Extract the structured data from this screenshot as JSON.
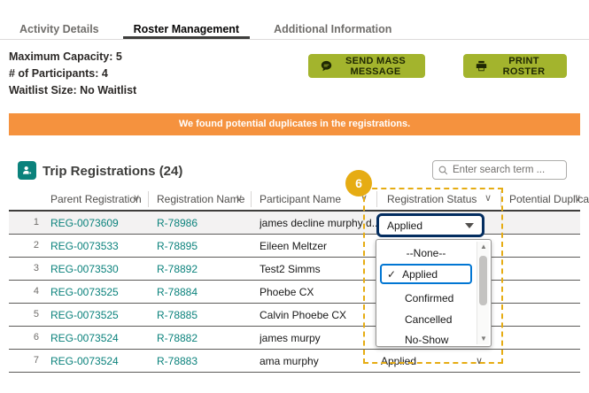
{
  "tabs": [
    {
      "label": "Activity Details",
      "active": false
    },
    {
      "label": "Roster Management",
      "active": true
    },
    {
      "label": "Additional Information",
      "active": false
    }
  ],
  "summary": {
    "max_capacity": "Maximum Capacity: 5",
    "participants": "# of Participants: 4",
    "waitlist": "Waitlist Size: No Waitlist"
  },
  "actions": {
    "send_mass_message": "SEND MASS MESSAGE",
    "print_roster": "PRINT ROSTER",
    "button_color": "#a3b42d"
  },
  "banner": {
    "text": "We found potential duplicates in the registrations.",
    "color": "#f5923e"
  },
  "section": {
    "title": "Trip Registrations (24)",
    "icon": "people-icon",
    "icon_color": "#0b827c"
  },
  "search": {
    "placeholder": "Enter search term ..."
  },
  "table": {
    "columns": [
      {
        "label": "Parent Registration"
      },
      {
        "label": "Registration Name"
      },
      {
        "label": "Participant Name"
      },
      {
        "label": "Registration Status"
      },
      {
        "label": "Potential Duplicate"
      }
    ],
    "link_color": "#0b827c",
    "rows": [
      {
        "num": "1",
        "parent": "REG-0073609",
        "reg_name": "R-78986",
        "participant": "james decline murphy d...",
        "status": "Applied",
        "duplicate": ""
      },
      {
        "num": "2",
        "parent": "REG-0073533",
        "reg_name": "R-78895",
        "participant": "Eileen Meltzer",
        "status": "",
        "duplicate": ""
      },
      {
        "num": "3",
        "parent": "REG-0073530",
        "reg_name": "R-78892",
        "participant": "Test2 Simms",
        "status": "",
        "duplicate": ""
      },
      {
        "num": "4",
        "parent": "REG-0073525",
        "reg_name": "R-78884",
        "participant": "Phoebe CX",
        "status": "",
        "duplicate": ""
      },
      {
        "num": "5",
        "parent": "REG-0073525",
        "reg_name": "R-78885",
        "participant": "Calvin Phoebe CX",
        "status": "",
        "duplicate": ""
      },
      {
        "num": "6",
        "parent": "REG-0073524",
        "reg_name": "R-78882",
        "participant": "james murpy",
        "status": "",
        "duplicate": ""
      },
      {
        "num": "7",
        "parent": "REG-0073524",
        "reg_name": "R-78883",
        "participant": "ama murphy",
        "status": "Applied",
        "duplicate": ""
      }
    ]
  },
  "status_dropdown": {
    "value": "Applied",
    "checkmark": "✓",
    "options": [
      {
        "label": "--None--",
        "selected": false
      },
      {
        "label": "Applied",
        "selected": true
      },
      {
        "label": "Confirmed",
        "selected": false
      },
      {
        "label": "Cancelled",
        "selected": false
      },
      {
        "label": "No-Show",
        "selected": false
      }
    ],
    "focus_border_color": "#032d60",
    "selected_border_color": "#0176d3"
  },
  "annotation": {
    "step_number": "6",
    "color": "#e6ac13"
  },
  "glyphs": {
    "chevron_down": "∨",
    "scroll_up": "▲",
    "scroll_down": "▼"
  }
}
